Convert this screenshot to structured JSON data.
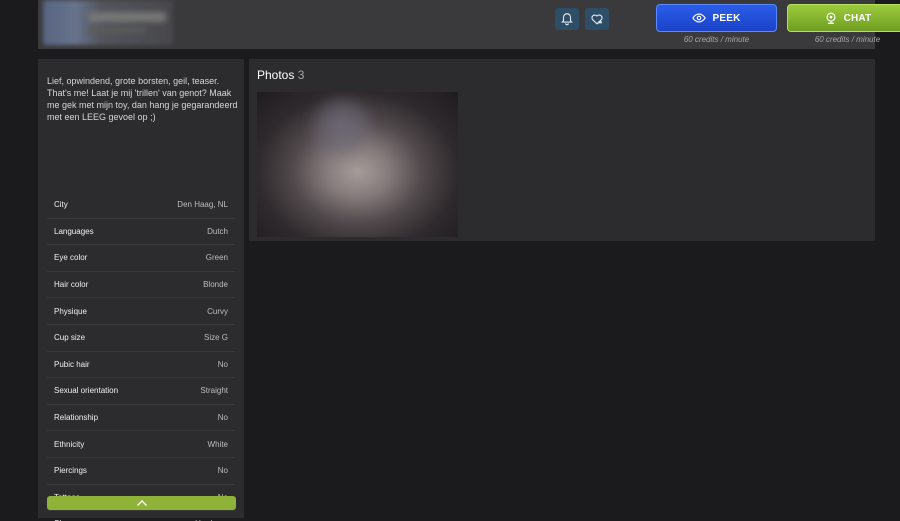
{
  "header": {
    "peek": {
      "label": "PEEK",
      "rate": "60 credits / minute",
      "color": "#1f4fd8"
    },
    "chat": {
      "label": "CHAT",
      "rate": "60 credits / minute",
      "color": "#84b52d"
    },
    "icons": [
      "bell-icon",
      "heart-chat-icon",
      "eye-icon",
      "webcam-icon"
    ]
  },
  "profile": {
    "bio": "Lief, opwindend, grote borsten, geil, teaser. That's me! Laat je mij 'trillen' van genot? Maak me gek met mijn toy, dan hang je gegarandeerd met een LEEG gevoel op ;)",
    "attributes": [
      {
        "key": "City",
        "value": "Den Haag, NL"
      },
      {
        "key": "Languages",
        "value": "Dutch"
      },
      {
        "key": "Eye color",
        "value": "Green"
      },
      {
        "key": "Hair color",
        "value": "Blonde"
      },
      {
        "key": "Physique",
        "value": "Curvy"
      },
      {
        "key": "Cup size",
        "value": "Size G"
      },
      {
        "key": "Pubic hair",
        "value": "No"
      },
      {
        "key": "Sexual orientation",
        "value": "Straight"
      },
      {
        "key": "Relationship",
        "value": "No"
      },
      {
        "key": "Ethnicity",
        "value": "White"
      },
      {
        "key": "Piercings",
        "value": "No"
      },
      {
        "key": "Tattoos",
        "value": "No"
      },
      {
        "key": "Shows",
        "value": "Hardcore"
      }
    ]
  },
  "photos": {
    "title": "Photos",
    "count": "3"
  }
}
